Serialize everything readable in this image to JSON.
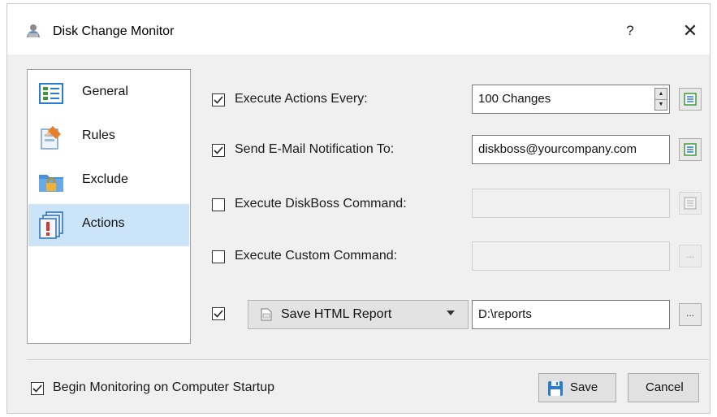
{
  "window": {
    "title": "Disk Change Monitor",
    "help_glyph": "?",
    "close_glyph": "✕"
  },
  "sidebar": {
    "items": [
      {
        "label": "General",
        "icon": "general-icon",
        "selected": false
      },
      {
        "label": "Rules",
        "icon": "rules-icon",
        "selected": false
      },
      {
        "label": "Exclude",
        "icon": "exclude-icon",
        "selected": false
      },
      {
        "label": "Actions",
        "icon": "actions-icon",
        "selected": true
      }
    ]
  },
  "actions": {
    "execute_every": {
      "label": "Execute Actions Every:",
      "checked": true,
      "value": "100 Changes"
    },
    "send_email": {
      "label": "Send E-Mail Notification To:",
      "checked": true,
      "value": "diskboss@yourcompany.com"
    },
    "diskboss_command": {
      "label": "Execute DiskBoss Command:",
      "checked": false,
      "value": ""
    },
    "custom_command": {
      "label": "Execute Custom Command:",
      "checked": false,
      "value": "",
      "browse_label": "..."
    },
    "report": {
      "checked": true,
      "type_label": "Save HTML Report",
      "path": "D:\\reports",
      "browse_label": "..."
    }
  },
  "footer": {
    "startup_label": "Begin Monitoring on Computer Startup",
    "startup_checked": true,
    "save_label": "Save",
    "cancel_label": "Cancel"
  },
  "colors": {
    "selected_bg": "#cce4f7",
    "accent_blue": "#2a7bd4",
    "icon_green": "#3a9a3a"
  }
}
